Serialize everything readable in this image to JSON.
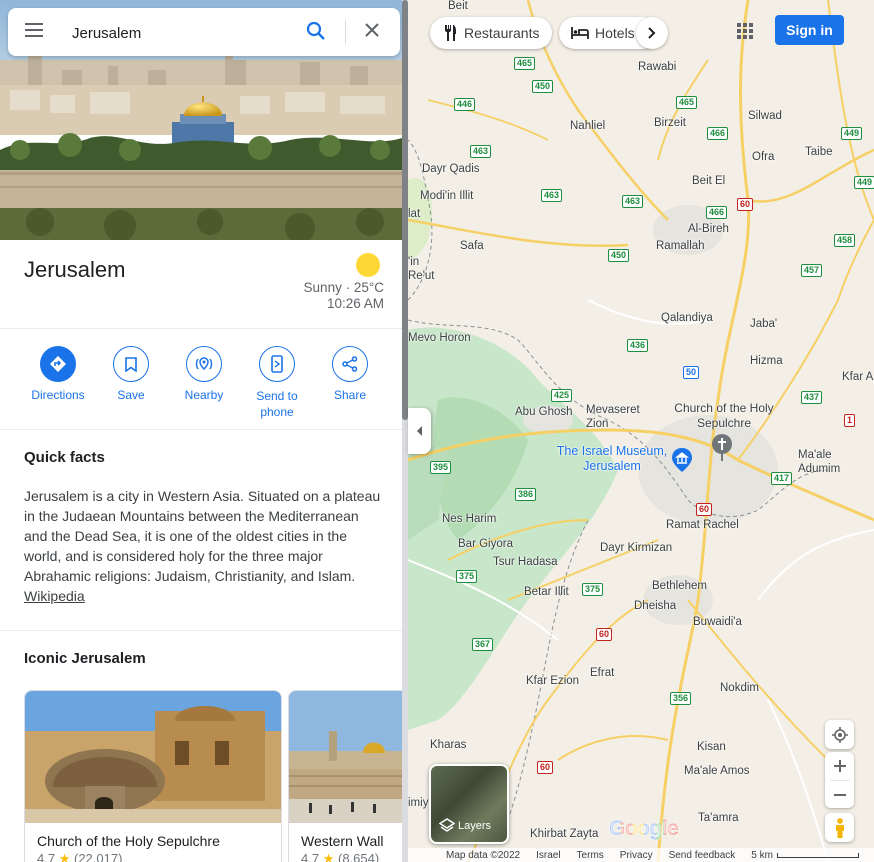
{
  "search": {
    "value": "Jerusalem"
  },
  "place": {
    "title": "Jerusalem",
    "weather_condition": "Sunny · 25°C",
    "weather_time": "10:26 AM"
  },
  "actions": [
    {
      "label": "Directions",
      "icon": "directions-icon"
    },
    {
      "label": "Save",
      "icon": "bookmark-icon"
    },
    {
      "label": "Nearby",
      "icon": "nearby-icon"
    },
    {
      "label": "Send to phone",
      "icon": "phone-icon"
    },
    {
      "label": "Share",
      "icon": "share-icon"
    }
  ],
  "quick_facts": {
    "heading": "Quick facts",
    "text": "Jerusalem is a city in Western Asia. Situated on a plateau in the Judaean Mountains between the Mediterranean and the Dead Sea, it is one of the oldest cities in the world, and is considered holy for the three major Abrahamic religions: Judaism, Christianity, and Islam.",
    "link": "Wikipedia"
  },
  "iconic": {
    "heading": "Iconic Jerusalem",
    "cards": [
      {
        "name": "Church of the Holy Sepulchre",
        "rating": "4.7",
        "reviews": "(22,017)"
      },
      {
        "name": "Western Wall",
        "rating": "4.7",
        "reviews": "(8,654)"
      }
    ]
  },
  "map_header": {
    "chips": [
      "Restaurants",
      "Hotels"
    ],
    "sign_in": "Sign in"
  },
  "map_labels": {
    "towns": [
      "Beit",
      "Rawabi",
      "Silwad",
      "Nahliel",
      "Birzeit",
      "Ofra",
      "Taibe",
      "Dayr Qadis",
      "Beit El",
      "Modi'in Illit",
      "Al-Bireh",
      "Safa",
      "Ramallah",
      "Qalandiya",
      "Jaba'",
      "Mevo Horon",
      "Hizma",
      "Kfar A",
      "Abu Ghosh",
      "Mevaseret Zion",
      "Church of the Holy Sepulchre",
      "The Israel Museum, Jerusalem",
      "Ma'ale Adumim",
      "Nes Harim",
      "Ramat Rachel",
      "Bar Giyora",
      "Tsur Hadasa",
      "Dayr Kirmizan",
      "Bethlehem",
      "Betar Illit",
      "Dheisha",
      "Buwaidi'a",
      "Kfar Ezion",
      "Efrat",
      "Nokdim",
      "Kharas",
      "Kisan",
      "Ma'ale Amos",
      "Ta'amra",
      "Khirbat Zayta",
      "Re'ut",
      "'in",
      "lat",
      "imiya"
    ],
    "routes": [
      "465",
      "450",
      "446",
      "463",
      "466",
      "465",
      "463",
      "463",
      "466",
      "60",
      "449",
      "449",
      "450",
      "458",
      "457",
      "436",
      "50",
      "425",
      "437",
      "1",
      "395",
      "417",
      "386",
      "60",
      "375",
      "375",
      "60",
      "367",
      "356",
      "60"
    ]
  },
  "map_controls": {
    "layers_label": "Layers",
    "logo": "Google",
    "footer": [
      "Map data ©2022",
      "Israel",
      "Terms",
      "Privacy",
      "Send feedback",
      "5 km"
    ]
  }
}
